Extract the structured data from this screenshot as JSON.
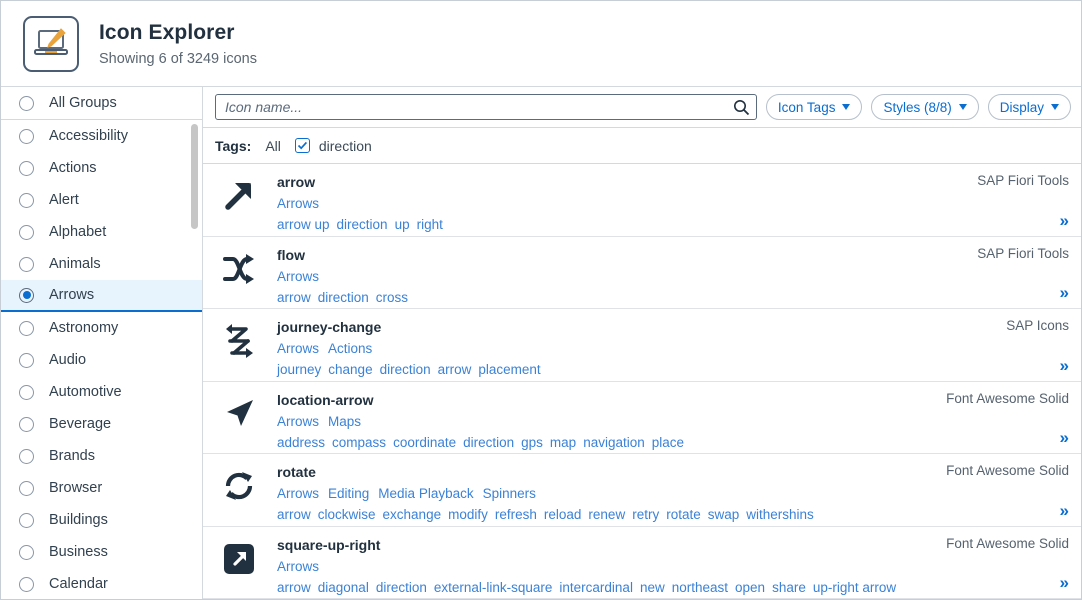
{
  "header": {
    "title": "Icon Explorer",
    "subtitle": "Showing 6 of 3249 icons",
    "logo_icon": "laptop-paintbrush-icon"
  },
  "sidebar": {
    "all_groups": {
      "label": "All Groups",
      "selected": false
    },
    "items": [
      {
        "label": "Accessibility",
        "selected": false
      },
      {
        "label": "Actions",
        "selected": false
      },
      {
        "label": "Alert",
        "selected": false
      },
      {
        "label": "Alphabet",
        "selected": false
      },
      {
        "label": "Animals",
        "selected": false
      },
      {
        "label": "Arrows",
        "selected": true
      },
      {
        "label": "Astronomy",
        "selected": false
      },
      {
        "label": "Audio",
        "selected": false
      },
      {
        "label": "Automotive",
        "selected": false
      },
      {
        "label": "Beverage",
        "selected": false
      },
      {
        "label": "Brands",
        "selected": false
      },
      {
        "label": "Browser",
        "selected": false
      },
      {
        "label": "Buildings",
        "selected": false
      },
      {
        "label": "Business",
        "selected": false
      },
      {
        "label": "Calendar",
        "selected": false
      }
    ]
  },
  "toolbar": {
    "search_placeholder": "Icon name...",
    "search_value": "",
    "search_icon": "search-icon",
    "buttons": [
      {
        "label": "Icon Tags",
        "icon": "chevron-down-icon"
      },
      {
        "label": "Styles (8/8)",
        "icon": "chevron-down-icon"
      },
      {
        "label": "Display",
        "icon": "chevron-down-icon"
      }
    ]
  },
  "tags_bar": {
    "label": "Tags:",
    "all_label": "All",
    "active_tag": "direction",
    "active_tag_checked": true
  },
  "results": [
    {
      "name": "arrow",
      "icon": "arrow-up-right-icon",
      "source": "SAP Fiori Tools",
      "categories": [
        "Arrows"
      ],
      "tags": [
        "arrow up",
        "direction",
        "up",
        "right"
      ],
      "expand": "»"
    },
    {
      "name": "flow",
      "icon": "flow-crossing-arrows-icon",
      "source": "SAP Fiori Tools",
      "categories": [
        "Arrows"
      ],
      "tags": [
        "arrow",
        "direction",
        "cross"
      ],
      "expand": "»"
    },
    {
      "name": "journey-change",
      "icon": "journey-change-zigzag-arrows-icon",
      "source": "SAP Icons",
      "categories": [
        "Arrows",
        "Actions"
      ],
      "tags": [
        "journey",
        "change",
        "direction",
        "arrow",
        "placement"
      ],
      "expand": "»"
    },
    {
      "name": "location-arrow",
      "icon": "location-arrow-icon",
      "source": "Font Awesome Solid",
      "categories": [
        "Arrows",
        "Maps"
      ],
      "tags": [
        "address",
        "compass",
        "coordinate",
        "direction",
        "gps",
        "map",
        "navigation",
        "place"
      ],
      "expand": "»"
    },
    {
      "name": "rotate",
      "icon": "rotate-icon",
      "source": "Font Awesome Solid",
      "categories": [
        "Arrows",
        "Editing",
        "Media Playback",
        "Spinners"
      ],
      "tags": [
        "arrow",
        "clockwise",
        "exchange",
        "modify",
        "refresh",
        "reload",
        "renew",
        "retry",
        "rotate",
        "swap",
        "withershins"
      ],
      "expand": "»"
    },
    {
      "name": "square-up-right",
      "icon": "square-up-right-icon",
      "source": "Font Awesome Solid",
      "categories": [
        "Arrows"
      ],
      "tags": [
        "arrow",
        "diagonal",
        "direction",
        "external-link-square",
        "intercardinal",
        "new",
        "northeast",
        "open",
        "share",
        "up-right arrow"
      ],
      "expand": "»"
    }
  ],
  "colors": {
    "accent_blue": "#0a6ed1",
    "link_blue": "#3b82d6",
    "text_dark": "#22313f",
    "muted": "#56626f",
    "selected_row_bg": "#e8f4fd",
    "logo_gold": "#e8a33d"
  }
}
